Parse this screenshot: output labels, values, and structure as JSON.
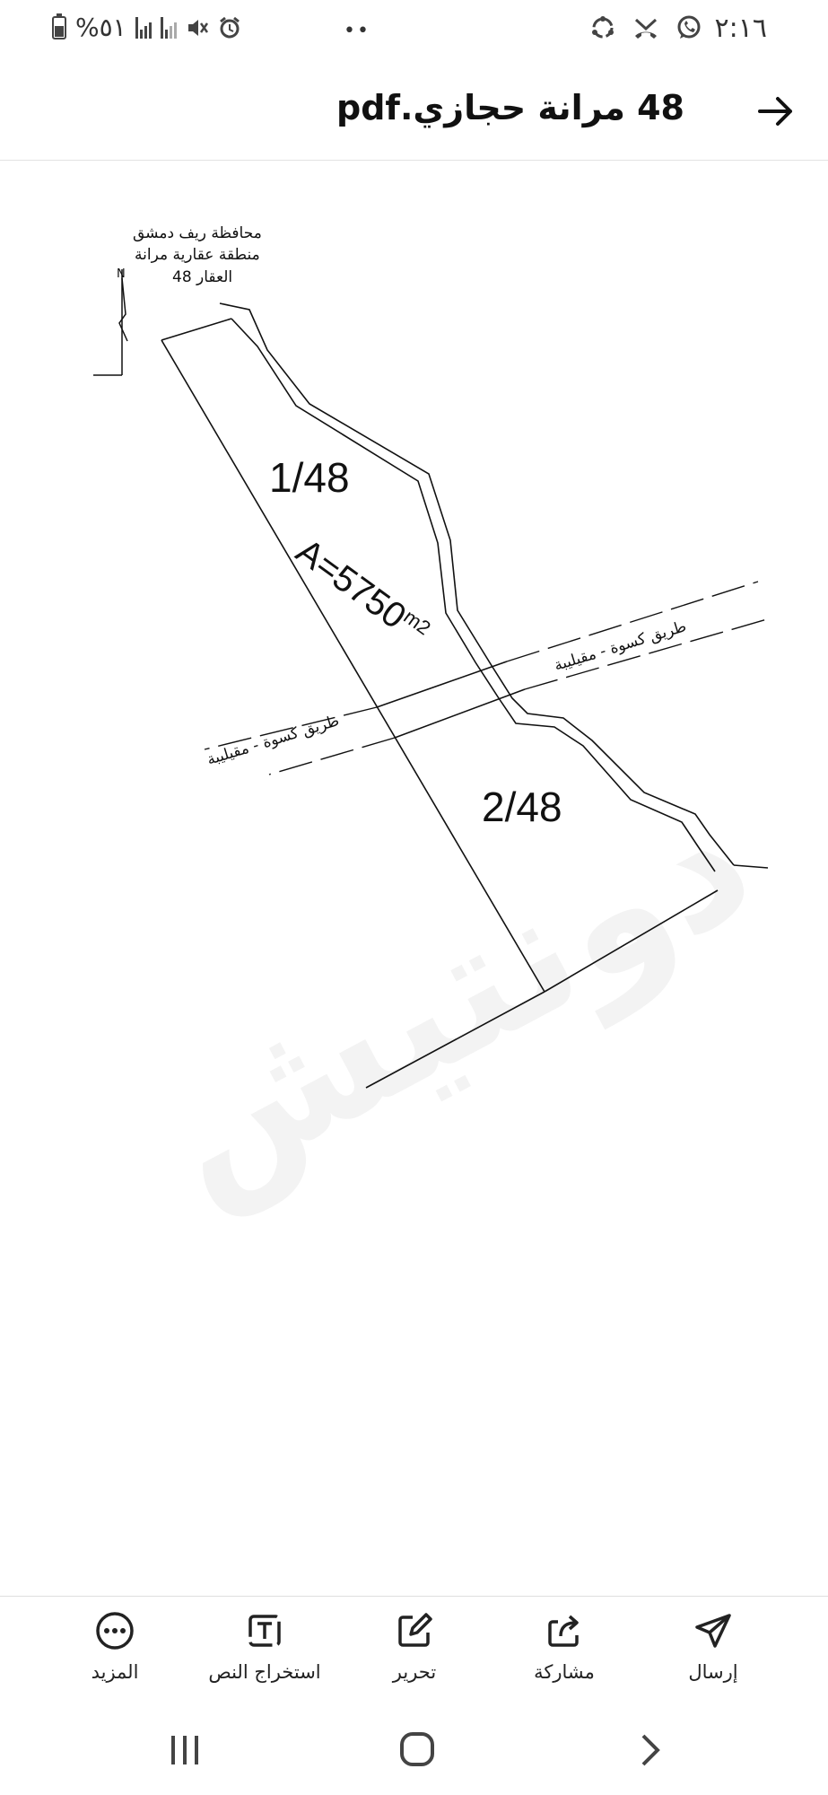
{
  "status_bar": {
    "time": "٢:١٦",
    "dots": "••",
    "battery_text": "%٥١"
  },
  "header": {
    "title": "48 مرانة حجازي.pdf",
    "back_icon": "arrow-right-icon"
  },
  "document": {
    "header_lines": [
      "محافظة ريف دمشق",
      "منطقة عقارية مرانة",
      "العقار  48"
    ],
    "north_label": "N",
    "parcel_1": "1/48",
    "parcel_2": "2/48",
    "area_label": "A=5750",
    "area_unit": "m2",
    "road_label": "طريق كسوة - مقيليبة",
    "watermark": "دونتيش"
  },
  "toolbar": {
    "items": [
      {
        "label": "المزيد",
        "icon": "more-icon"
      },
      {
        "label": "استخراج النص",
        "icon": "extract-text-icon"
      },
      {
        "label": "تحرير",
        "icon": "edit-icon"
      },
      {
        "label": "مشاركة",
        "icon": "share-icon"
      },
      {
        "label": "إرسال",
        "icon": "send-icon"
      }
    ]
  },
  "nav_bar": {
    "icons": [
      "recent-apps-icon",
      "home-icon",
      "back-icon"
    ]
  }
}
